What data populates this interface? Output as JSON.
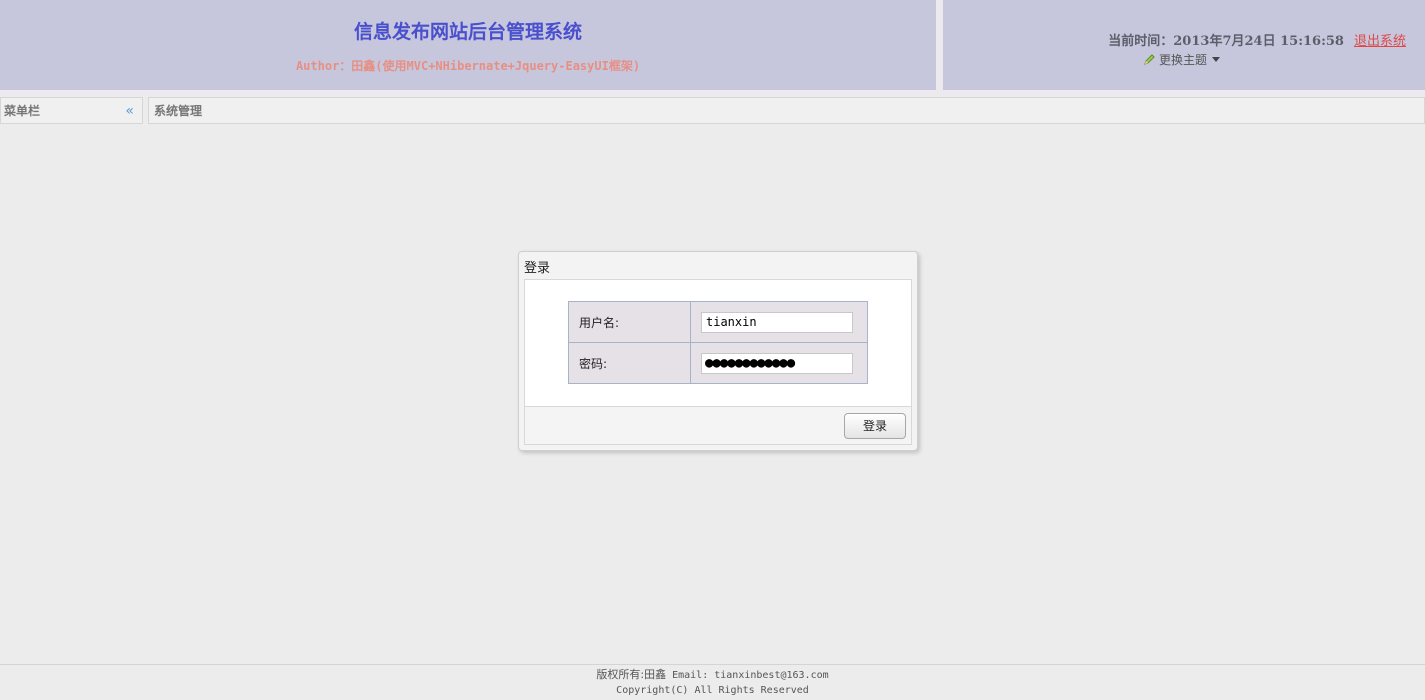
{
  "header": {
    "title": "信息发布网站后台管理系统",
    "author": "Author：田鑫(使用MVC+NHibernate+Jquery-EasyUI框架)",
    "time_label": "当前时间：",
    "time_value": "2013年7月24日 15:16:58",
    "logout": "退出系统",
    "theme": "更换主题"
  },
  "menu_panel": {
    "title": "菜单栏",
    "collapse_glyph": "«"
  },
  "main_panel": {
    "title": "系统管理"
  },
  "login": {
    "title": "登录",
    "username_label": "用户名:",
    "username_value": "tianxin",
    "password_label": "密码:",
    "password_mask": "●●●●●●●●●●●●",
    "submit": "登录"
  },
  "footer": {
    "line1_prefix": "版权所有:田鑫",
    "line1_email": " Email: tianxinbest@163.com",
    "line2": "Copyright(C) All Rights Reserved"
  },
  "colors": {
    "header_bg": "#c6c7dd",
    "title": "#4a4fce",
    "author": "#e88f84",
    "logout": "#e04848",
    "page_bg": "#ececec"
  },
  "icons": [
    "pencil-icon",
    "caret-down-icon",
    "double-chevron-left-icon"
  ]
}
